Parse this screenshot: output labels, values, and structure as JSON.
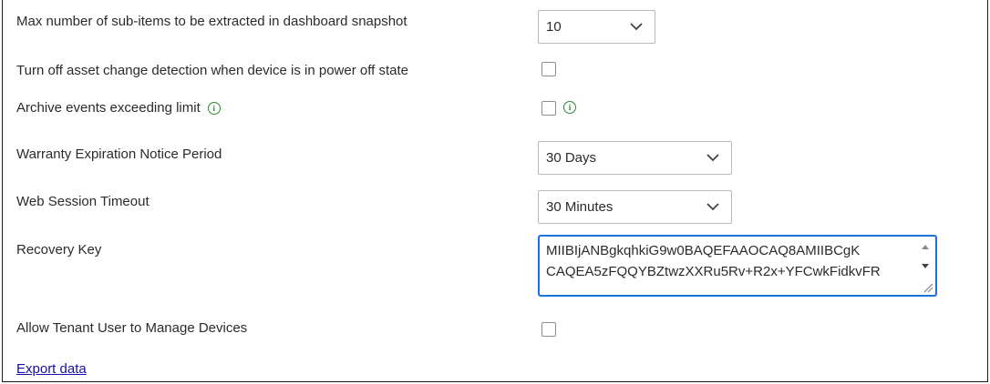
{
  "settings": {
    "max_subitems": {
      "label": "Max number of sub-items to be extracted in dashboard snapshot",
      "value": "10"
    },
    "asset_change": {
      "label": "Turn off asset change detection when device is in power off state"
    },
    "archive_events": {
      "label": "Archive events exceeding limit",
      "info_icon": "i"
    },
    "warranty": {
      "label": "Warranty Expiration Notice Period",
      "value": "30 Days"
    },
    "web_session": {
      "label": "Web Session Timeout",
      "value": "30 Minutes"
    },
    "recovery_key": {
      "label": "Recovery Key",
      "line1": "MIIBIjANBgkqhkiG9w0BAQEFAAOCAQ8AMIIBCgK",
      "line2": "CAQEA5zFQQYBZtwzXXRu5Rv+R2x+YFCwkFidkvFR"
    },
    "tenant_user": {
      "label": "Allow Tenant User to Manage Devices"
    }
  },
  "export_link": "Export data",
  "colors": {
    "info_green": "#2e8b2e",
    "focus_blue": "#1a73d9",
    "link_blue": "#1a0dab"
  }
}
